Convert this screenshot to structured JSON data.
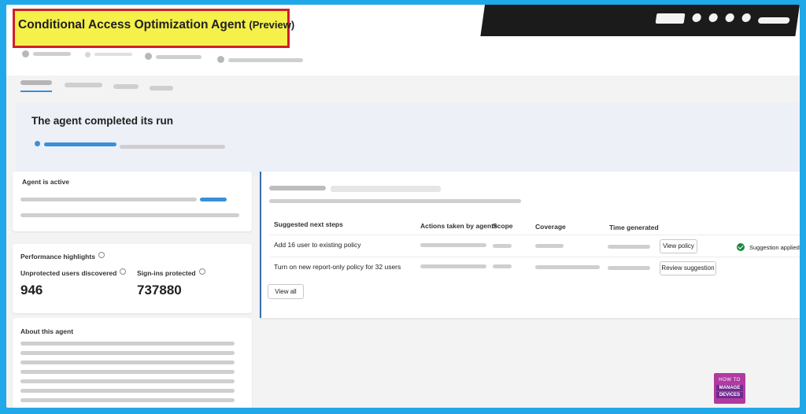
{
  "page": {
    "title": "Conditional Access Optimization Agent",
    "title_badge": "(Preview)"
  },
  "banner": {
    "title": "The agent completed its run"
  },
  "status_card": {
    "title": "Agent is active"
  },
  "performance": {
    "title": "Performance highlights",
    "metrics": [
      {
        "label": "Unprotected users discovered",
        "value": "946"
      },
      {
        "label": "Sign-ins protected",
        "value": "737880"
      }
    ]
  },
  "about": {
    "title": "About this agent"
  },
  "suggestions": {
    "columns": [
      "Suggested next steps",
      "Actions taken by agents",
      "Scope",
      "Coverage",
      "Time generated"
    ],
    "rows": [
      {
        "step": "Add 16 user to existing policy",
        "action_label": "View policy",
        "status": "Suggestion applied"
      },
      {
        "step": "Turn on new report-only policy for 32 users",
        "action_label": "Review suggestion",
        "status": ""
      }
    ],
    "view_all_label": "View all"
  },
  "watermark": {
    "line1": "HOW TO",
    "line2": "MANAGE",
    "line3": "DEVICES"
  },
  "colors": {
    "accent": "#3a8fd8",
    "highlight": "#f5f04a",
    "highlight_border": "#d11f27",
    "success": "#1b8a3a",
    "outer_border": "#20a8e8"
  }
}
